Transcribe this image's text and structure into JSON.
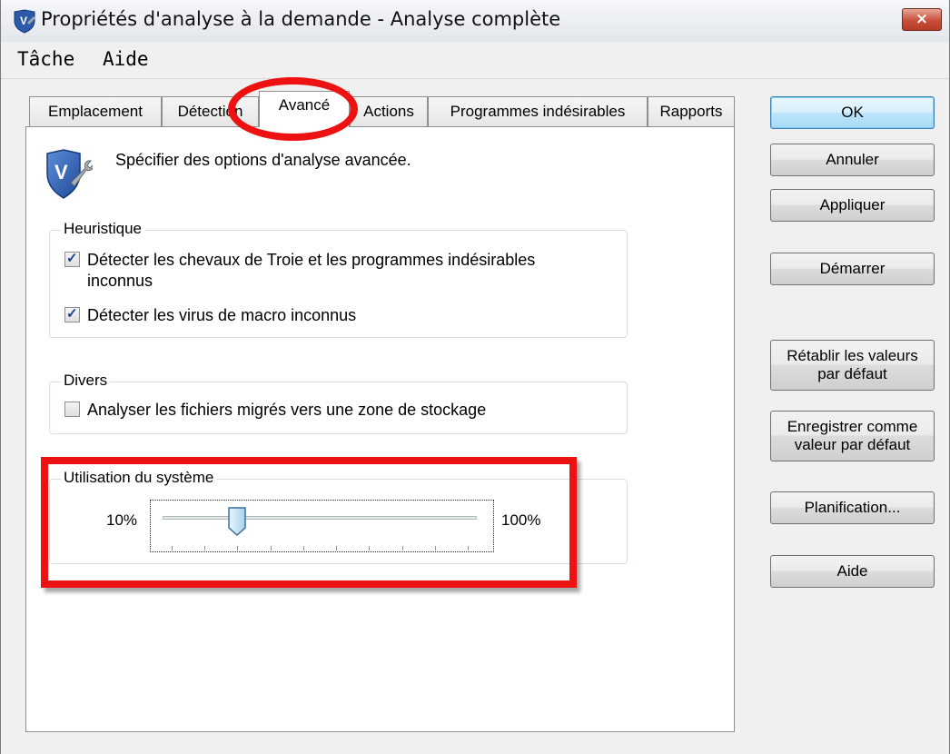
{
  "window": {
    "title": "Propriétés d'analyse à la demande - Analyse complète",
    "close_glyph": "×"
  },
  "menu": {
    "items": [
      {
        "label": "Tâche",
        "mnemonic": "T"
      },
      {
        "label": "Aide",
        "mnemonic": "A"
      }
    ]
  },
  "tabs": [
    {
      "label": "Emplacement",
      "active": false
    },
    {
      "label": "Détection",
      "active": false
    },
    {
      "label": "Avancé",
      "active": true
    },
    {
      "label": "Actions",
      "active": false
    },
    {
      "label": "Programmes indésirables",
      "active": false
    },
    {
      "label": "Rapports",
      "active": false
    }
  ],
  "panel": {
    "header_text": "Spécifier des options d'analyse avancée.",
    "header_icon": "mcafee-shield-wrench-icon",
    "heuristique": {
      "title": "Heuristique",
      "options": [
        {
          "label_line1": "Détecter les chevaux de Troie et les programmes indésirables",
          "label_line2": "inconnus",
          "checked": true
        },
        {
          "label_line1": "Détecter les virus de macro inconnus",
          "checked": true
        }
      ]
    },
    "divers": {
      "title": "Divers",
      "options": [
        {
          "label_line1": "Analyser les fichiers migrés vers une zone de stockage",
          "checked": false
        }
      ]
    },
    "utilisation": {
      "title": "Utilisation du système",
      "min_label": "10%",
      "max_label": "100%",
      "level_fraction": 0.222,
      "tick_count": 10
    }
  },
  "buttons": {
    "ok": "OK",
    "annuler": "Annuler",
    "appliquer": "Appliquer",
    "demarrer": "Démarrer",
    "retablir_line1": "Rétablir les valeurs",
    "retablir_line2": "par défaut",
    "enregistrer_line1": "Enregistrer comme",
    "enregistrer_line2": "valeur par défaut",
    "planification": "Planification...",
    "aide": "Aide"
  },
  "colors": {
    "highlight": "#ee1111",
    "checkmark": "#1c3f8c",
    "default_button": "#bee6fd"
  }
}
